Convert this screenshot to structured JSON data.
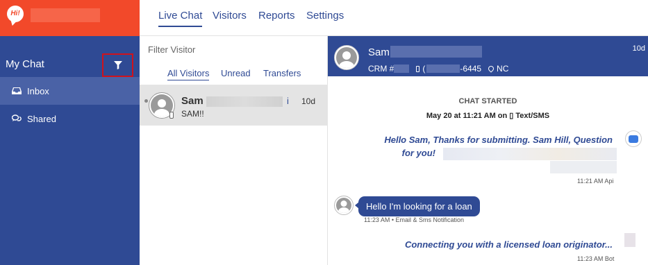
{
  "sidebar": {
    "logo_text": "Hi!",
    "section_title": "My Chat",
    "items": [
      {
        "label": "Inbox",
        "icon": "inbox-icon"
      },
      {
        "label": "Shared",
        "icon": "chat-bubbles-icon"
      }
    ]
  },
  "topnav": {
    "tabs": [
      "Live Chat",
      "Visitors",
      "Reports",
      "Settings"
    ]
  },
  "visitor_list": {
    "filter_placeholder": "Filter Visitor",
    "subtabs": [
      "All Visitors",
      "Unread",
      "Transfers"
    ],
    "visitors": [
      {
        "name": "Sam",
        "name_suffix": "i",
        "preview": "SAM!!",
        "time": "10d"
      }
    ]
  },
  "chat": {
    "header": {
      "name": "Sam",
      "crm_label": "CRM #",
      "phone_prefix": "(",
      "phone_suffix": "-6445",
      "state": "NC",
      "time": "10d"
    },
    "started_label": "CHAT STARTED",
    "started_date": "May 20 at 11:21 AM on ▯ Text/SMS",
    "messages": [
      {
        "from": "bot",
        "text_line1": "Hello Sam, Thanks for submitting. Sam Hill, Question",
        "text_line2": "for you!",
        "meta": "11:21 AM Api"
      },
      {
        "from": "visitor",
        "text": "Hello I'm looking for a loan",
        "meta": "11:23 AM • Email & Sms Notification"
      },
      {
        "from": "bot",
        "text": "Connecting you with a licensed loan originator...",
        "meta": "11:23 AM Bot"
      }
    ]
  },
  "colors": {
    "brand_orange": "#f2492a",
    "sidebar_blue": "#2f4a94",
    "highlight_red": "#d0121b"
  }
}
